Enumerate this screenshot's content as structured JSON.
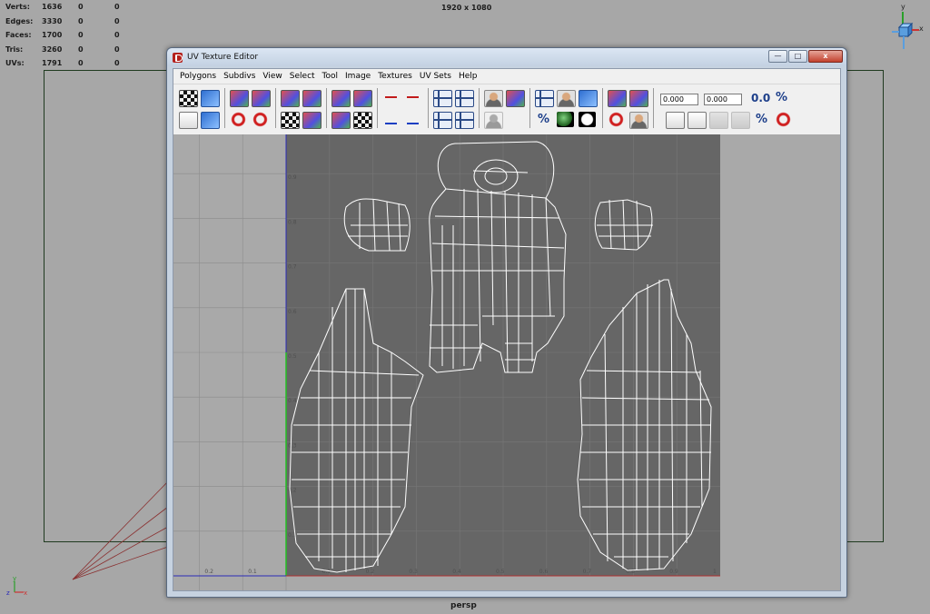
{
  "stats": {
    "rows": [
      {
        "label": "Verts:",
        "value": "1636",
        "sel": "0",
        "comp": "0"
      },
      {
        "label": "Edges:",
        "value": "3330",
        "sel": "0",
        "comp": "0"
      },
      {
        "label": "Faces:",
        "value": "1700",
        "sel": "0",
        "comp": "0"
      },
      {
        "label": "Tris:",
        "value": "3260",
        "sel": "0",
        "comp": "0"
      },
      {
        "label": "UVs:",
        "value": "1791",
        "sel": "0",
        "comp": "0"
      }
    ]
  },
  "viewport": {
    "resolution": "1920 x 1080",
    "camera": "persp",
    "cube_axes": {
      "y": "y",
      "x": "x"
    },
    "corner_axes": {
      "y": "y",
      "z": "z",
      "x": "x"
    }
  },
  "uv_editor": {
    "title": "UV Texture Editor",
    "window_buttons": {
      "minimize": "—",
      "maximize": "□",
      "close": "x"
    },
    "menus": [
      "Polygons",
      "Subdivs",
      "View",
      "Select",
      "Tool",
      "Image",
      "Textures",
      "UV Sets",
      "Help"
    ],
    "u_value": "0.000",
    "v_value": "0.000",
    "uv_readout": "0.0",
    "pct_label": "%",
    "v_ticks": [
      "1",
      "0.9",
      "0.8",
      "0.7",
      "0.6",
      "0.5",
      "0.4",
      "0.3",
      "0.2",
      "0.1"
    ],
    "u_ticks_neg": [
      "0.2",
      "0.1"
    ],
    "u_ticks_pos": [
      "0.1",
      "0.2",
      "0.3",
      "0.4",
      "0.5",
      "0.6",
      "0.7",
      "0.8",
      "0.9",
      "1"
    ],
    "colors": {
      "texture_bg": "#666666",
      "grid_bg": "#a9a9a9",
      "wire": "#ffffff",
      "u_axis": "#b03030",
      "v_axis": "#2a2ab8",
      "v_axis_sel": "#22c022"
    }
  }
}
